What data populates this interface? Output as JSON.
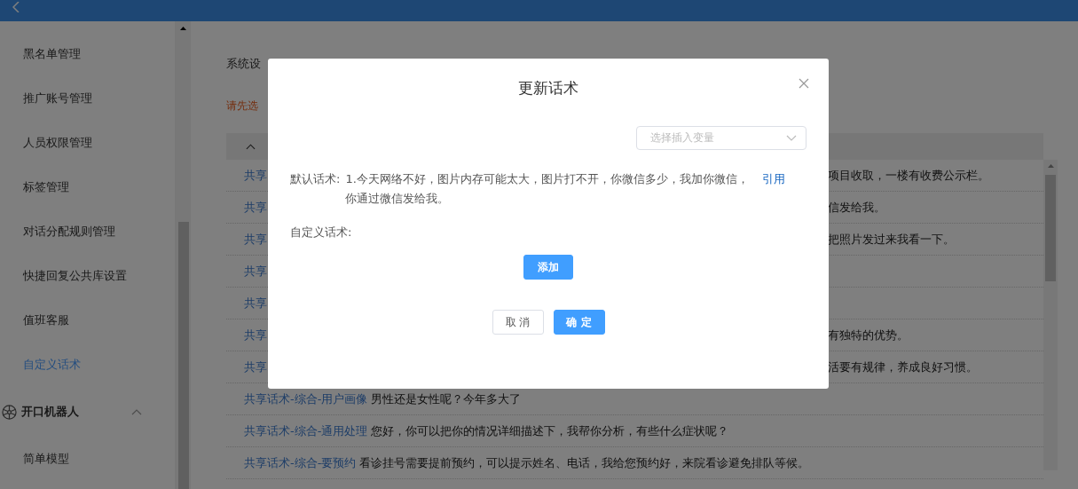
{
  "sidebar": {
    "items": [
      {
        "kind": "item",
        "label": "黑名单管理",
        "selected": false
      },
      {
        "kind": "item",
        "label": "推广账号管理",
        "selected": false
      },
      {
        "kind": "item",
        "label": "人员权限管理",
        "selected": false
      },
      {
        "kind": "item",
        "label": "标签管理",
        "selected": false
      },
      {
        "kind": "item",
        "label": "对话分配规则管理",
        "selected": false
      },
      {
        "kind": "item",
        "label": "快捷回复公共库设置",
        "selected": false
      },
      {
        "kind": "item",
        "label": "值班客服",
        "selected": false
      },
      {
        "kind": "item",
        "label": "自定义话术",
        "selected": true
      },
      {
        "kind": "group",
        "label": "开口机器人",
        "expanded": true
      },
      {
        "kind": "item",
        "label": "简单模型",
        "selected": false
      }
    ]
  },
  "breadcrumb": "系统设",
  "notice": "请先选",
  "table": {
    "group_expanded": true,
    "rows": [
      {
        "title": "共享",
        "tail": "项目收取，一楼有收费公示栏。"
      },
      {
        "title": "共享",
        "tail": "信发给我。"
      },
      {
        "title": "共享",
        "tail": "把照片发过来我看一下。"
      },
      {
        "title": "共享"
      },
      {
        "title": "共享"
      },
      {
        "title": "共享",
        "tail": "有独特的优势。"
      },
      {
        "title": "共享",
        "tail": "活要有规律，养成良好习惯。"
      },
      {
        "title": "共享话术-综合-用户画像",
        "text": "男性还是女性呢？今年多大了"
      },
      {
        "title": "共享话术-综合-通用处理",
        "text": "您好，你可以把你的情况详细描述下，我帮你分析，有些什么症状呢？"
      },
      {
        "title": "共享话术-综合-要预约",
        "text": "看诊挂号需要提前预约，可以提示姓名、电话，我给您预约好，来院看诊避免排队等候。"
      }
    ]
  },
  "modal": {
    "title": "更新话术",
    "select": {
      "placeholder": "选择插入变量"
    },
    "default_label": "默认话术:",
    "default_text": "1.今天网络不好，图片内存可能太大，图片打不开，你微信多少，我加你微信，你通过微信发给我。",
    "quote_link": "引用",
    "custom_label": "自定义话术:",
    "add_button": "添加",
    "cancel_button": "取 消",
    "ok_button": "确 定"
  }
}
